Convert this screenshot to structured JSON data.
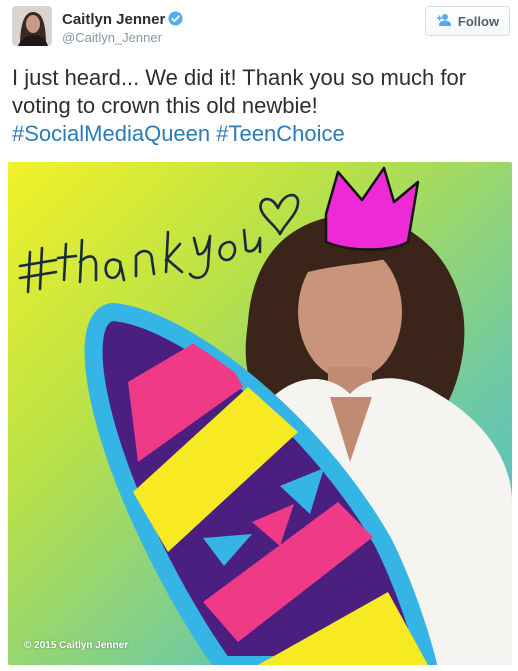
{
  "user": {
    "name": "Caitlyn Jenner",
    "handle": "@Caitlyn_Jenner",
    "verified": true
  },
  "follow_button": {
    "label": "Follow",
    "icon": "add-user-icon"
  },
  "tweet": {
    "text": "I just heard... We did it! Thank you so much for voting to crown this old newbie!",
    "hashtags": [
      "#SocialMediaQueen",
      "#TeenChoice"
    ]
  },
  "media": {
    "handwriting": "#thankyou",
    "copyright": "© 2015 Caitlyn Jenner"
  },
  "colors": {
    "hashtag": "#2b7bb9",
    "verified": "#55acee",
    "crown": "#ee2ad6",
    "surfboard_rim": "#35b4e6",
    "surfboard_body": "#4b1f80",
    "stripe_pink": "#ef3b87",
    "stripe_yellow": "#f7ea22",
    "stripe_blue": "#35b4e6"
  }
}
